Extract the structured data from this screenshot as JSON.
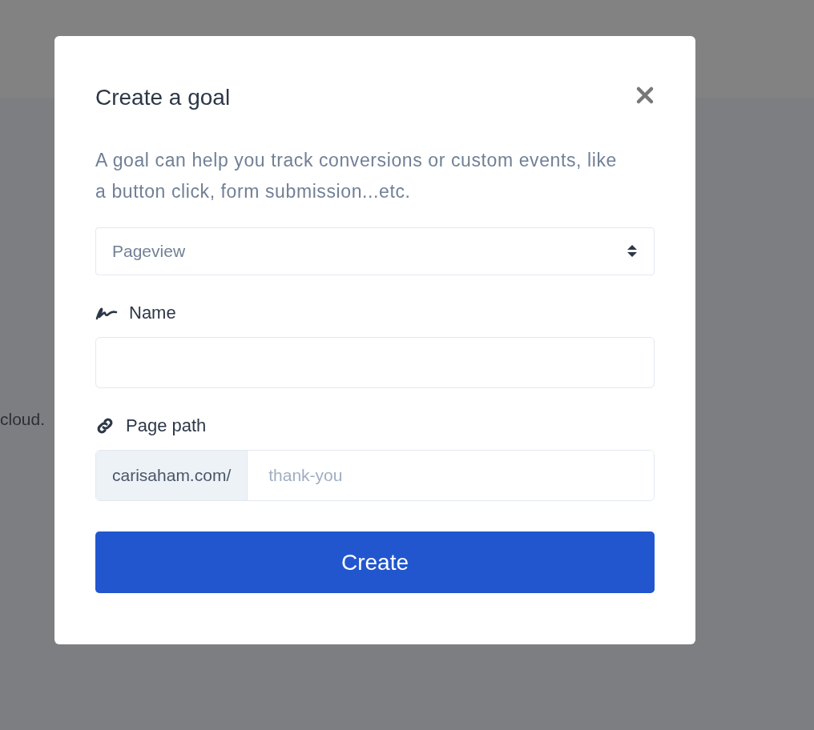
{
  "background_page": {
    "text": "cloud."
  },
  "modal": {
    "title": "Create a goal",
    "description": "A goal can help you track conversions or custom events, like a button click, form submission...etc.",
    "goal_type": {
      "value": "Pageview"
    },
    "fields": [
      {
        "kind": "text",
        "label": "Name"
      },
      {
        "kind": "path",
        "label": "Page path",
        "prefix": "carisaham.com/",
        "placeholder": "thank-you"
      }
    ],
    "submit_button": "Create"
  }
}
